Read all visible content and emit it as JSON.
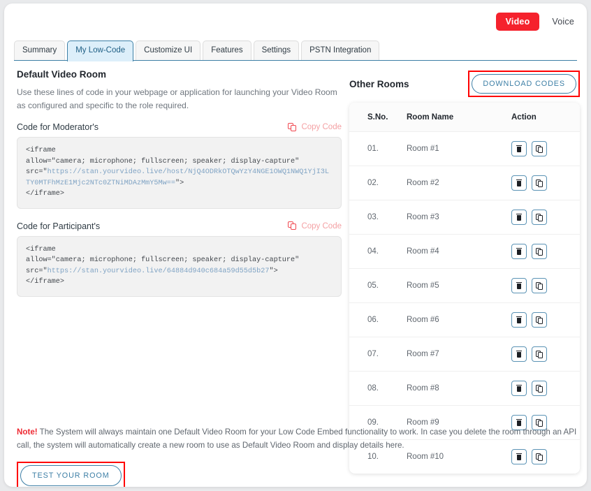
{
  "media_toggle": {
    "video_label": "Video",
    "voice_label": "Voice",
    "active": "Video",
    "active_color": "#f5222d"
  },
  "tabs": [
    {
      "label": "Summary",
      "active": false
    },
    {
      "label": "My Low-Code",
      "active": true
    },
    {
      "label": "Customize UI",
      "active": false
    },
    {
      "label": "Features",
      "active": false
    },
    {
      "label": "Settings",
      "active": false
    },
    {
      "label": "PSTN Integration",
      "active": false
    }
  ],
  "left": {
    "title": "Default Video Room",
    "description": "Use these lines of code in your webpage or application for launching your Video Room as configured and specific to the role required.",
    "moderator": {
      "label": "Code for Moderator's",
      "copy_label": "Copy Code",
      "code_prefix": "<iframe\nallow=\"camera; microphone; fullscreen; speaker; display-capture\"\nsrc=\"",
      "code_url": "https://stan.yourvideo.live/host/NjQ4ODRkOTQwYzY4NGE1OWQ1NWQ1YjI3LTY0MTFhMzE1Mjc2NTc0ZTNiMDAzMmY5Mw==",
      "code_suffix": "\">\n</iframe>"
    },
    "participant": {
      "label": "Code for Participant's",
      "copy_label": "Copy Code",
      "code_prefix": "<iframe\nallow=\"camera; microphone; fullscreen; speaker; display-capture\"\nsrc=\"",
      "code_url": "https://stan.yourvideo.live/64884d940c684a59d55d5b27",
      "code_suffix": "\">\n</iframe>"
    }
  },
  "right": {
    "title": "Other Rooms",
    "download_button": "DOWNLOAD CODES",
    "download_highlight_color": "#ff0000",
    "table": {
      "headers": [
        "S.No.",
        "Room Name",
        "Action"
      ],
      "rows": [
        {
          "sno": "01.",
          "name": "Room #1"
        },
        {
          "sno": "02.",
          "name": "Room #2"
        },
        {
          "sno": "03.",
          "name": "Room #3"
        },
        {
          "sno": "04.",
          "name": "Room #4"
        },
        {
          "sno": "05.",
          "name": "Room #5"
        },
        {
          "sno": "06.",
          "name": "Room #6"
        },
        {
          "sno": "07.",
          "name": "Room #7"
        },
        {
          "sno": "08.",
          "name": "Room #8"
        },
        {
          "sno": "09.",
          "name": "Room #9"
        },
        {
          "sno": "10.",
          "name": "Room #10"
        }
      ]
    }
  },
  "footer": {
    "note_tag": "Note!",
    "note_text": " The System will always maintain one Default Video Room for your Low Code Embed functionality to work. In case you delete the room through an API call, the system will automatically create a new room to use as Default Video Room and display details here.",
    "test_button": "TEST YOUR ROOM",
    "test_highlight_color": "#ff0000"
  }
}
